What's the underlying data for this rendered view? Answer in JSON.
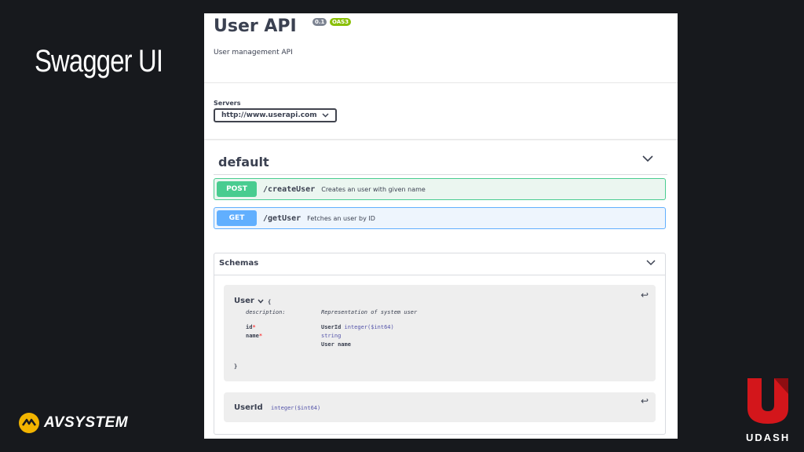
{
  "slide": {
    "title": "Swagger UI"
  },
  "branding": {
    "left_logo": "AVSYSTEM",
    "right_logo": "UDASH",
    "accent": "#f2b400",
    "udash_red": "#d3161b"
  },
  "swagger": {
    "title": "User API",
    "version_badge": "0.1",
    "oas_badge": "OAS3",
    "description": "User management API",
    "servers_label": "Servers",
    "server_selected": "http://www.userapi.com",
    "section": "default",
    "operations": [
      {
        "method": "POST",
        "path": "/createUser",
        "summary": "Creates an user with given name",
        "color": "#49cc90"
      },
      {
        "method": "GET",
        "path": "/getUser",
        "summary": "Fetches an user by ID",
        "color": "#61affe"
      }
    ],
    "schemas": {
      "title": "Schemas",
      "user": {
        "name": "User",
        "open_brace": "{",
        "close_brace": "}",
        "description_key": "description:",
        "description_value": "Representation of system user",
        "properties": [
          {
            "name": "id",
            "required": "*",
            "type": "UserId",
            "format": "integer($int64)"
          },
          {
            "name": "name",
            "required": "*",
            "type": "string",
            "extra": "User name"
          }
        ]
      },
      "userid": {
        "name": "UserId",
        "format": "integer($int64)"
      }
    }
  }
}
